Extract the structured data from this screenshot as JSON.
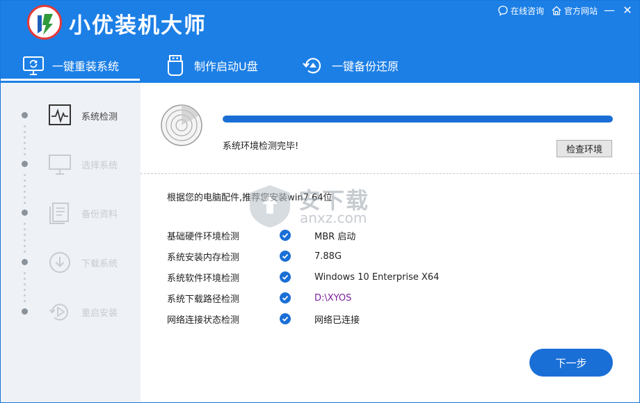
{
  "header": {
    "app_title": "小优装机大师",
    "logo_text": "优",
    "links": [
      {
        "label": "在线咨询",
        "icon": "chat-icon"
      },
      {
        "label": "官方网站",
        "icon": "home-icon"
      }
    ],
    "minimize_glyph": "—",
    "close_glyph": "✕"
  },
  "tabs": [
    {
      "label": "一键重装系统",
      "icon": "monitor-refresh-icon",
      "active": true
    },
    {
      "label": "制作启动U盘",
      "icon": "usb-icon",
      "active": false
    },
    {
      "label": "一键备份还原",
      "icon": "restore-icon",
      "active": false
    }
  ],
  "sidebar": {
    "steps": [
      {
        "label": "系统检测",
        "icon": "pulse-monitor-icon",
        "active": true
      },
      {
        "label": "选择系统",
        "icon": "monitor-icon",
        "active": false
      },
      {
        "label": "备份资料",
        "icon": "document-icon",
        "active": false
      },
      {
        "label": "下载系统",
        "icon": "download-icon",
        "active": false
      },
      {
        "label": "重启安装",
        "icon": "restart-icon",
        "active": false
      }
    ]
  },
  "main": {
    "progress_percent": 100,
    "status_text": "系统环境检测完毕!",
    "check_env_label": "检查环境",
    "recommend_text": "根据您的电脑配件,推荐您安装win7 64位",
    "checks": [
      {
        "label": "基础硬件环境检测",
        "value": "MBR 启动",
        "highlight": false
      },
      {
        "label": "系统安装内存检测",
        "value": "7.88G",
        "highlight": false
      },
      {
        "label": "系统软件环境检测",
        "value": "Windows 10 Enterprise X64",
        "highlight": false
      },
      {
        "label": "系统下载路径检测",
        "value": "D:\\XYOS",
        "highlight": true
      },
      {
        "label": "网络连接状态检测",
        "value": "网络已连接",
        "highlight": false
      }
    ],
    "next_label": "下一步"
  },
  "watermark": {
    "cn": "安下载",
    "en": "anxz.com"
  },
  "colors": {
    "header_bg": "#1c7fe6",
    "accent": "#1a6fd6",
    "sidebar_bg": "#eef1f5",
    "highlight_value": "#7a1f9a"
  }
}
